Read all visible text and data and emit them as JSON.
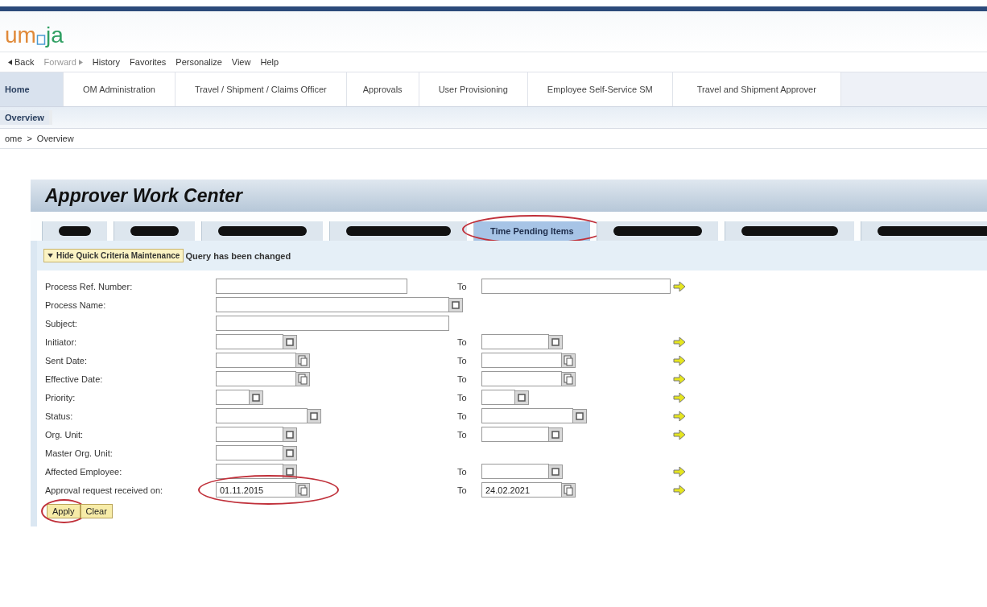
{
  "logo": {
    "before": "um",
    "after": "ja"
  },
  "menu": [
    {
      "label": "Back",
      "kind": "back",
      "disabled": false
    },
    {
      "label": "Forward",
      "kind": "forward",
      "disabled": true
    },
    {
      "label": "History",
      "kind": "plain",
      "disabled": false
    },
    {
      "label": "Favorites",
      "kind": "plain",
      "disabled": false
    },
    {
      "label": "Personalize",
      "kind": "plain",
      "disabled": false
    },
    {
      "label": "View",
      "kind": "plain",
      "disabled": false
    },
    {
      "label": "Help",
      "kind": "plain",
      "disabled": false
    }
  ],
  "nav_tabs": [
    {
      "label": "Home",
      "selected": true
    },
    {
      "label": "OM Administration",
      "selected": false
    },
    {
      "label": "Travel / Shipment / Claims Officer",
      "selected": false
    },
    {
      "label": "Approvals",
      "selected": false
    },
    {
      "label": "User Provisioning",
      "selected": false
    },
    {
      "label": "Employee Self-Service SM",
      "selected": false
    },
    {
      "label": "Travel and Shipment Approver",
      "selected": false
    }
  ],
  "sub_nav": [
    {
      "label": "Overview",
      "selected": true
    }
  ],
  "breadcrumb": [
    "ome",
    ">",
    "Overview"
  ],
  "panel": {
    "title": "Approver Work Center",
    "tabs": [
      {
        "kind": "redacted",
        "selected": false,
        "circled": false
      },
      {
        "kind": "redacted",
        "selected": false,
        "circled": false
      },
      {
        "kind": "redacted",
        "selected": false,
        "circled": false
      },
      {
        "kind": "redacted",
        "selected": false,
        "circled": false
      },
      {
        "kind": "label",
        "label": "Time Pending Items",
        "selected": true,
        "circled": true
      },
      {
        "kind": "redacted",
        "selected": false,
        "circled": false
      },
      {
        "kind": "redacted",
        "selected": false,
        "circled": false
      },
      {
        "kind": "redacted",
        "selected": false,
        "circled": false
      }
    ],
    "toggle_button": "Hide Quick Criteria Maintenance",
    "status": "Query has been changed",
    "criteria": [
      {
        "label": "Process Ref. Number:",
        "from": {
          "kind": "text",
          "circled": false
        },
        "to": {
          "kind": "text"
        },
        "to_label": "To"
      },
      {
        "label": "Process Name:",
        "from": {
          "kind": "lookup",
          "circled": false
        }
      },
      {
        "label": "Subject:",
        "from": {
          "kind": "text",
          "circled": false
        }
      },
      {
        "label": "Initiator:",
        "from": {
          "kind": "lookup",
          "circled": false
        },
        "to": {
          "kind": "lookup"
        },
        "to_label": "To"
      },
      {
        "label": "Sent Date:",
        "from": {
          "kind": "date",
          "circled": false
        },
        "to": {
          "kind": "date"
        },
        "to_label": "To"
      },
      {
        "label": "Effective Date:",
        "from": {
          "kind": "date",
          "circled": false
        },
        "to": {
          "kind": "date"
        },
        "to_label": "To"
      },
      {
        "label": "Priority:",
        "from": {
          "kind": "lookup",
          "circled": false
        },
        "to": {
          "kind": "lookup"
        },
        "to_label": "To"
      },
      {
        "label": "Status:",
        "from": {
          "kind": "lookup",
          "circled": false
        },
        "to": {
          "kind": "lookup"
        },
        "to_label": "To"
      },
      {
        "label": "Org. Unit:",
        "from": {
          "kind": "lookup",
          "circled": false
        },
        "to": {
          "kind": "lookup"
        },
        "to_label": "To"
      },
      {
        "label": "Master Org. Unit:",
        "from": {
          "kind": "lookup",
          "circled": false
        }
      },
      {
        "label": "Affected Employee:",
        "from": {
          "kind": "lookup",
          "circled": false
        },
        "to": {
          "kind": "lookup"
        },
        "to_label": "To"
      },
      {
        "label": "Approval request received on:",
        "from": {
          "kind": "date",
          "value": "01.11.2015",
          "circled": true
        },
        "to": {
          "kind": "date",
          "value": "24.02.2021"
        },
        "to_label": "To"
      }
    ],
    "buttons": [
      {
        "label": "Apply",
        "circled": true
      },
      {
        "label": "Clear",
        "circled": false
      }
    ]
  }
}
